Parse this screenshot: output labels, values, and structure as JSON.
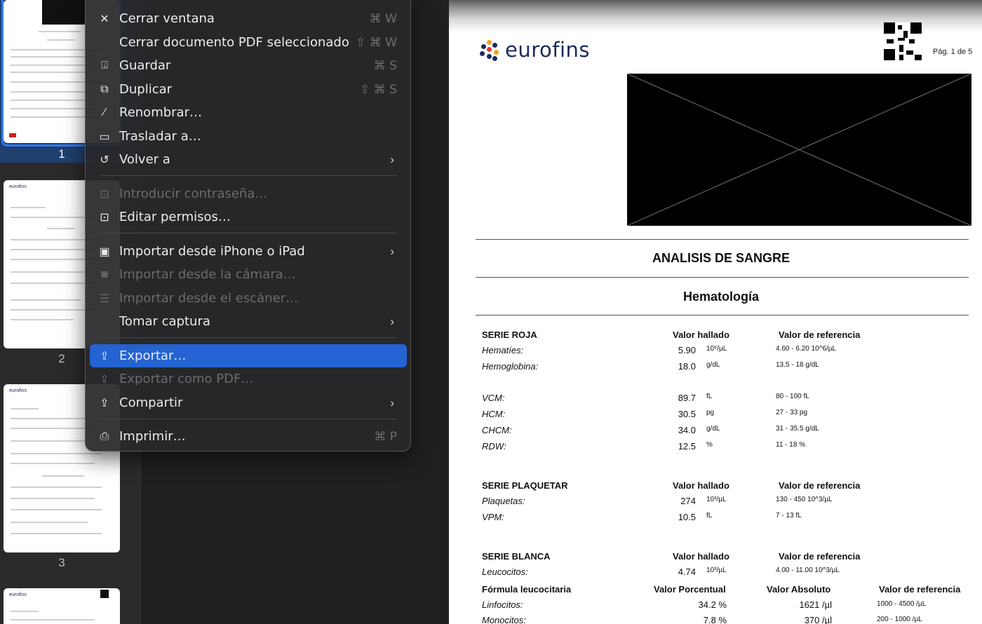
{
  "sidebar": {
    "thumbnails": [
      {
        "number": "1",
        "logo": ""
      },
      {
        "number": "2",
        "logo": "eurofins"
      },
      {
        "number": "3",
        "logo": "eurofins"
      },
      {
        "number": "",
        "logo": "eurofins"
      }
    ]
  },
  "menu": {
    "items": [
      {
        "label": "Cerrar ventana",
        "shortcut": "⌘ W"
      },
      {
        "label": "Cerrar documento PDF seleccionado",
        "shortcut": "⇧ ⌘ W"
      },
      {
        "label": "Guardar",
        "shortcut": "⌘ S"
      },
      {
        "label": "Duplicar",
        "shortcut": "⇧ ⌘ S"
      },
      {
        "label": "Renombrar…"
      },
      {
        "label": "Trasladar a…"
      },
      {
        "label": "Volver a"
      },
      {
        "label": "Introducir contraseña…"
      },
      {
        "label": "Editar permisos…"
      },
      {
        "label": "Importar desde iPhone o iPad"
      },
      {
        "label": "Importar desde la cámara…"
      },
      {
        "label": "Importar desde el escáner…"
      },
      {
        "label": "Tomar captura"
      },
      {
        "label": "Exportar…"
      },
      {
        "label": "Exportar como PDF…"
      },
      {
        "label": "Compartir"
      },
      {
        "label": "Imprimir…",
        "shortcut": "⌘ P"
      }
    ]
  },
  "pdf": {
    "logo_text": "eurofins",
    "page_label": "Pág. 1 de 5",
    "title": "ANALISIS DE SANGRE",
    "section": "Hematología",
    "headers": {
      "valor": "Valor hallado",
      "ref": "Valor de referencia"
    },
    "serie_roja": {
      "title": "SERIE ROJA",
      "rows": [
        {
          "name": "Hematíes:",
          "value": "5.90",
          "unit": "10⁶/µL",
          "ref": "4.60 - 6.20 10^6/µL"
        },
        {
          "name": "Hemoglobina:",
          "value": "18.0",
          "unit": "g/dL",
          "ref": "13.5 - 18 g/dL"
        },
        {
          "name": "VCM:",
          "value": "89.7",
          "unit": "fL",
          "ref": "80 - 100 fL"
        },
        {
          "name": "HCM:",
          "value": "30.5",
          "unit": "pg",
          "ref": "27 - 33 pg"
        },
        {
          "name": "CHCM:",
          "value": "34.0",
          "unit": "g/dL",
          "ref": "31 - 35.5 g/dL"
        },
        {
          "name": "RDW:",
          "value": "12.5",
          "unit": "%",
          "ref": "11 - 18 %"
        }
      ]
    },
    "serie_plaquetar": {
      "title": "SERIE PLAQUETAR",
      "rows": [
        {
          "name": "Plaquetas:",
          "value": "274",
          "unit": "10³/µL",
          "ref": "130 - 450 10^3/µL"
        },
        {
          "name": "VPM:",
          "value": "10.5",
          "unit": "fL",
          "ref": "7 - 13 fL"
        }
      ]
    },
    "serie_blanca": {
      "title": "SERIE BLANCA",
      "rows": [
        {
          "name": "Leucocitos:",
          "value": "4.74",
          "unit": "10³/µL",
          "ref": "4.00 - 11.00 10^3/µL"
        }
      ]
    },
    "formula": {
      "title": "Fórmula leucocitaria",
      "col_pct": "Valor Porcentual",
      "col_abs": "Valor Absoluto",
      "col_ref": "Valor de referencia",
      "rows": [
        {
          "name": "Linfocitos:",
          "pct": "34.2 %",
          "abs": "1621 /µl",
          "ref": "1000 - 4500 /µL"
        },
        {
          "name": "Monocitos:",
          "pct": "7.8 %",
          "abs": "370 /µl",
          "ref": "200 - 1000 /µL"
        }
      ]
    }
  }
}
